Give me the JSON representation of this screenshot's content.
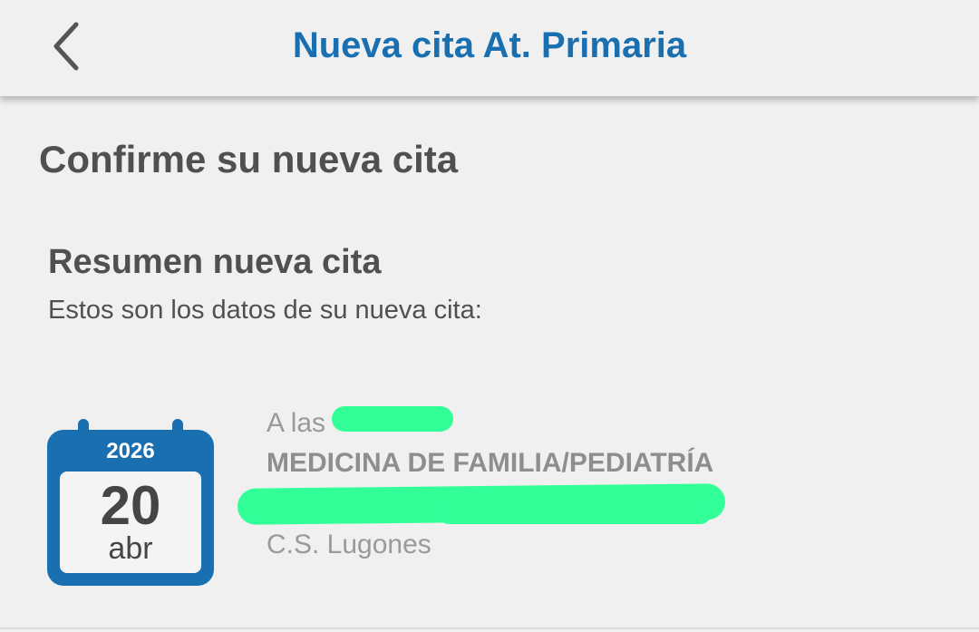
{
  "header": {
    "title": "Nueva cita At. Primaria",
    "back_icon": "chevron-left-icon"
  },
  "page": {
    "title": "Confirme su nueva cita"
  },
  "summary": {
    "title": "Resumen nueva cita",
    "subtitle": "Estos son los datos de su nueva cita:"
  },
  "appointment": {
    "year": "2026",
    "day": "20",
    "month": "abr",
    "time_label": "A las",
    "service": "MEDICINA DE FAMILIA/PEDIATRÍA",
    "center": "C.S. Lugones"
  },
  "colors": {
    "accent": "#1a6fb0",
    "background": "#f0f0f0",
    "redaction": "#33ff99"
  }
}
